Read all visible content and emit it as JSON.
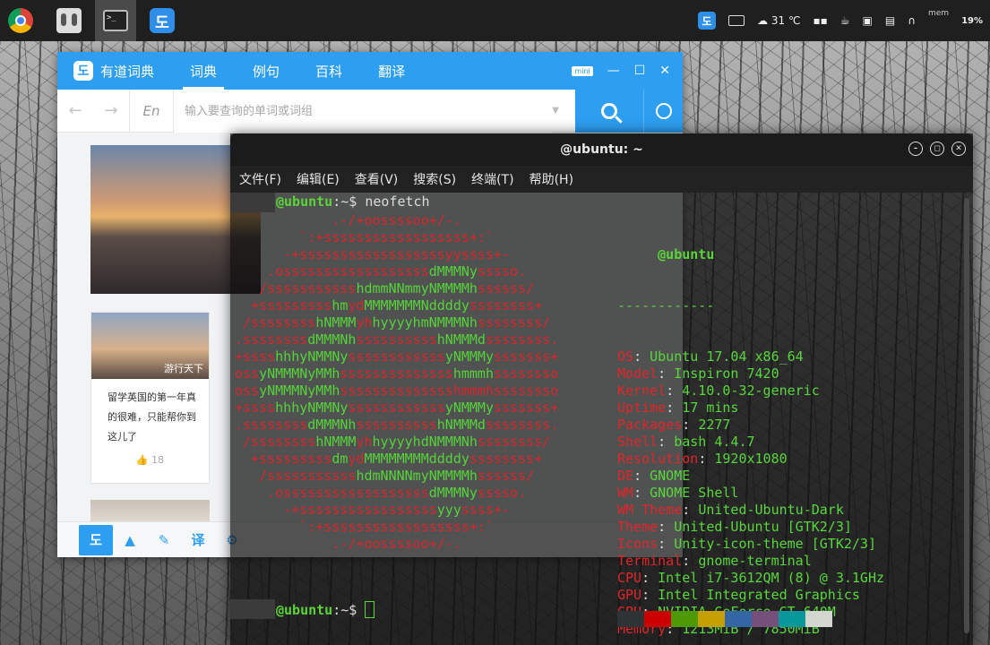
{
  "topbar": {
    "launchers": [
      "chrome-icon",
      "system-monitor-icon",
      "terminal-icon",
      "youdao-icon"
    ],
    "weather": "31 ℃",
    "mem_label": "mem",
    "mem_percent": "19%"
  },
  "youdao": {
    "brand": "有道词典",
    "tabs": [
      {
        "label": "词典"
      },
      {
        "label": "例句"
      },
      {
        "label": "百科"
      },
      {
        "label": "翻译"
      }
    ],
    "mini_label": "mini",
    "lang": "En",
    "search_placeholder": "输入要查询的单词或词组",
    "card": {
      "tag": "游行天下",
      "text": "留学英国的第一年真的很难，只能帮你到这儿了",
      "likes": "18"
    }
  },
  "terminal": {
    "title": "@ubuntu: ~",
    "menu": [
      "文件(F)",
      "编辑(E)",
      "查看(V)",
      "搜索(S)",
      "终端(T)",
      "帮助(H)"
    ],
    "prompt_host": "@ubuntu",
    "prompt_path": ":~$ ",
    "command": "neofetch",
    "info_header": "@ubuntu",
    "info_sep": "------------",
    "info": [
      {
        "k": "OS",
        "v": "Ubuntu 17.04 x86_64"
      },
      {
        "k": "Model",
        "v": "Inspiron 7420"
      },
      {
        "k": "Kernel",
        "v": "4.10.0-32-generic"
      },
      {
        "k": "Uptime",
        "v": "17 mins"
      },
      {
        "k": "Packages",
        "v": "2277"
      },
      {
        "k": "Shell",
        "v": "bash 4.4.7"
      },
      {
        "k": "Resolution",
        "v": "1920x1080"
      },
      {
        "k": "DE",
        "v": "GNOME"
      },
      {
        "k": "WM",
        "v": "GNOME Shell"
      },
      {
        "k": "WM Theme",
        "v": "United-Ubuntu-Dark"
      },
      {
        "k": "Theme",
        "v": "United-Ubuntu [GTK2/3]"
      },
      {
        "k": "Icons",
        "v": "Unity-icon-theme [GTK2/3]"
      },
      {
        "k": "Terminal",
        "v": "gnome-terminal"
      },
      {
        "k": "CPU",
        "v": "Intel i7-3612QM (8) @ 3.1GHz"
      },
      {
        "k": "GPU",
        "v": "Intel Integrated Graphics"
      },
      {
        "k": "GPU",
        "v": "NVIDIA GeForce GT 640M"
      },
      {
        "k": "Memory",
        "v": "1213MiB / 7850MiB"
      }
    ],
    "palette": [
      "#2e3436",
      "#cc0000",
      "#4e9a06",
      "#c4a000",
      "#3465a4",
      "#75507b",
      "#06989a",
      "#d3d7cf"
    ],
    "art": [
      [
        [
          "r",
          "            .-/+oossssoo+/-."
        ]
      ],
      [
        [
          "r",
          "        `:+ssssssssssssssssss+:`"
        ]
      ],
      [
        [
          "r",
          "      -+ssssssssssssssssssyyssss+-"
        ]
      ],
      [
        [
          "r",
          "    .ossssssssssssssssss"
        ],
        [
          "g",
          "dMMMNy"
        ],
        [
          "r",
          "sssso."
        ]
      ],
      [
        [
          "r",
          "   /sssssssssss"
        ],
        [
          "g",
          "hdmmNNmmyNMMMMh"
        ],
        [
          "r",
          "ssssss/"
        ]
      ],
      [
        [
          "r",
          "  +sssssssss"
        ],
        [
          "g",
          "hm"
        ],
        [
          "r",
          "yd"
        ],
        [
          "g",
          "MMMMMMMNddddy"
        ],
        [
          "r",
          "ssssssss+"
        ]
      ],
      [
        [
          "r",
          " /ssssssss"
        ],
        [
          "g",
          "hNMMM"
        ],
        [
          "r",
          "yh"
        ],
        [
          "g",
          "hyyyyhmNMMMNh"
        ],
        [
          "r",
          "ssssssss/"
        ]
      ],
      [
        [
          "r",
          ".ssssssss"
        ],
        [
          "g",
          "dMMMNh"
        ],
        [
          "r",
          "ssssssssss"
        ],
        [
          "g",
          "hNMMMd"
        ],
        [
          "r",
          "ssssssss."
        ]
      ],
      [
        [
          "r",
          "+ssss"
        ],
        [
          "g",
          "hhhyNMMNy"
        ],
        [
          "r",
          "ssssssssssss"
        ],
        [
          "g",
          "yNMMMy"
        ],
        [
          "r",
          "sssssss+"
        ]
      ],
      [
        [
          "r",
          "oss"
        ],
        [
          "g",
          "yNMMMNyMMh"
        ],
        [
          "r",
          "ssssssssssssss"
        ],
        [
          "g",
          "hmmmh"
        ],
        [
          "r",
          "ssssssso"
        ]
      ],
      [
        [
          "r",
          "oss"
        ],
        [
          "g",
          "yNMMMNyMMh"
        ],
        [
          "r",
          "sssssssssssssshmmmhssssssso"
        ]
      ],
      [
        [
          "r",
          "+ssss"
        ],
        [
          "g",
          "hhhyNMMNy"
        ],
        [
          "r",
          "ssssssssssss"
        ],
        [
          "g",
          "yNMMMy"
        ],
        [
          "r",
          "sssssss+"
        ]
      ],
      [
        [
          "r",
          ".ssssssss"
        ],
        [
          "g",
          "dMMMNh"
        ],
        [
          "r",
          "ssssssssss"
        ],
        [
          "g",
          "hNMMMd"
        ],
        [
          "r",
          "ssssssss."
        ]
      ],
      [
        [
          "r",
          " /ssssssss"
        ],
        [
          "g",
          "hNMMM"
        ],
        [
          "r",
          "yh"
        ],
        [
          "g",
          "hyyyyhdNMMMNh"
        ],
        [
          "r",
          "ssssssss/"
        ]
      ],
      [
        [
          "r",
          "  +sssssssss"
        ],
        [
          "g",
          "dm"
        ],
        [
          "r",
          "yd"
        ],
        [
          "g",
          "MMMMMMMMddddy"
        ],
        [
          "r",
          "ssssssss+"
        ]
      ],
      [
        [
          "r",
          "   /sssssssssss"
        ],
        [
          "g",
          "hdmNNNNmyNMMMMh"
        ],
        [
          "r",
          "ssssss/"
        ]
      ],
      [
        [
          "r",
          "    .ossssssssssssssssss"
        ],
        [
          "g",
          "dMMMNy"
        ],
        [
          "r",
          "sssso."
        ]
      ],
      [
        [
          "r",
          "      -+sssssssssssssssss"
        ],
        [
          "g",
          "yyy"
        ],
        [
          "r",
          "ssss+-"
        ]
      ],
      [
        [
          "r",
          "        `:+ssssssssssssssssss+:`"
        ]
      ],
      [
        [
          "r",
          "            .-/+oossssoo+/-."
        ]
      ]
    ]
  }
}
